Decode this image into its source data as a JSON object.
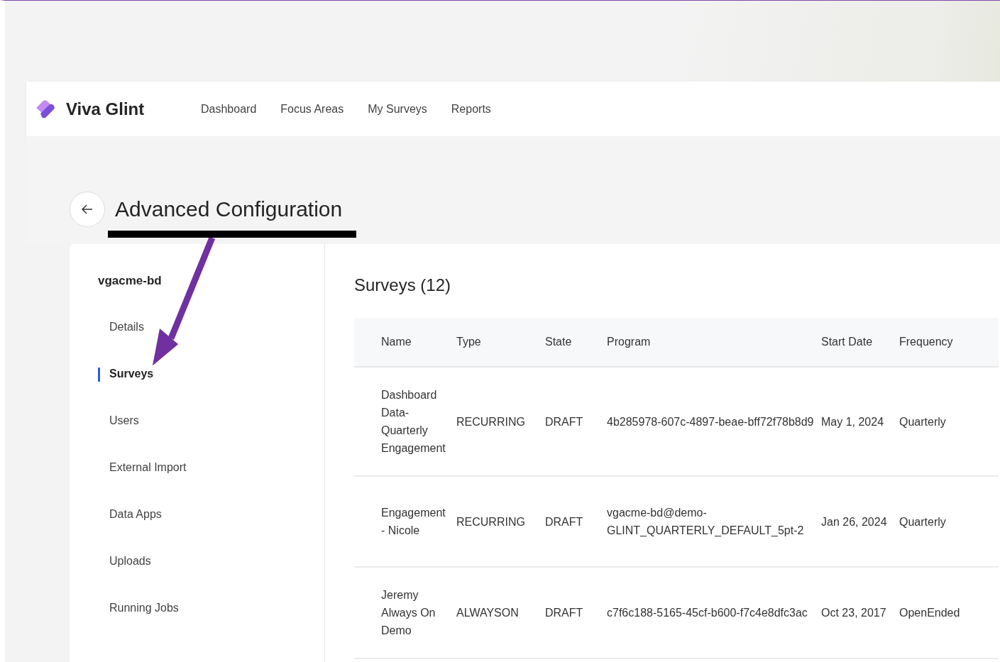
{
  "header": {
    "brand": "Viva Glint",
    "nav": [
      {
        "label": "Dashboard"
      },
      {
        "label": "Focus Areas"
      },
      {
        "label": "My Surveys"
      },
      {
        "label": "Reports"
      }
    ]
  },
  "page": {
    "title": "Advanced Configuration"
  },
  "sidebar": {
    "heading": "vgacme-bd",
    "items": [
      {
        "label": "Details",
        "selected": false
      },
      {
        "label": "Surveys",
        "selected": true
      },
      {
        "label": "Users",
        "selected": false
      },
      {
        "label": "External Import",
        "selected": false
      },
      {
        "label": "Data Apps",
        "selected": false
      },
      {
        "label": "Uploads",
        "selected": false
      },
      {
        "label": "Running Jobs",
        "selected": false
      }
    ]
  },
  "main": {
    "title": "Surveys (12)"
  },
  "table": {
    "columns": [
      "Name",
      "Type",
      "State",
      "Program",
      "Start Date",
      "Frequency"
    ],
    "rows": [
      [
        "Dashboard Data-Quarterly Engagement",
        "RECURRING",
        "DRAFT",
        "4b285978-607c-4897-beae-bff72f78b8d9",
        "May 1, 2024",
        "Quarterly"
      ],
      [
        "Engagement - Nicole",
        "RECURRING",
        "DRAFT",
        "vgacme-bd@demo-GLINT_QUARTERLY_DEFAULT_5pt-2",
        "Jan 26, 2024",
        "Quarterly"
      ],
      [
        "Jeremy Always On Demo",
        "ALWAYSON",
        "DRAFT",
        "c7f6c188-5165-45cf-b600-f7c4e8dfc3ac",
        "Oct 23, 2017",
        "OpenEnded"
      ]
    ]
  }
}
